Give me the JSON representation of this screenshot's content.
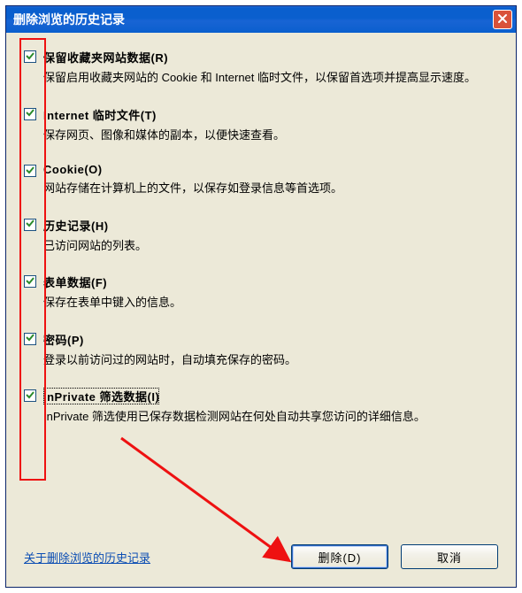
{
  "window": {
    "title": "删除浏览的历史记录"
  },
  "options": [
    {
      "label": "保留收藏夹网站数据(R)",
      "desc": "保留启用收藏夹网站的 Cookie 和 Internet 临时文件，以保留首选项并提高显示速度。",
      "checked": true
    },
    {
      "label": "Internet 临时文件(T)",
      "desc": "保存网页、图像和媒体的副本，以便快速查看。",
      "checked": true
    },
    {
      "label": "Cookie(O)",
      "desc": "网站存储在计算机上的文件，以保存如登录信息等首选项。",
      "checked": true
    },
    {
      "label": "历史记录(H)",
      "desc": "已访问网站的列表。",
      "checked": true
    },
    {
      "label": "表单数据(F)",
      "desc": "保存在表单中键入的信息。",
      "checked": true
    },
    {
      "label": "密码(P)",
      "desc": "登录以前访问过的网站时，自动填充保存的密码。",
      "checked": true
    },
    {
      "label": "InPrivate 筛选数据(I)",
      "desc": "InPrivate 筛选使用已保存数据检测网站在何处自动共享您访问的详细信息。",
      "checked": true,
      "focused": true
    }
  ],
  "footer": {
    "link": "关于删除浏览的历史记录",
    "delete": "删除(D)",
    "cancel": "取消"
  }
}
